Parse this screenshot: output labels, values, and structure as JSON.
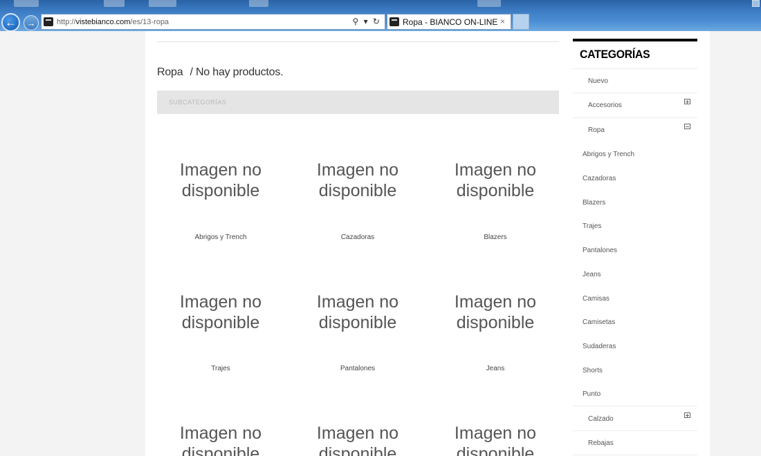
{
  "browser": {
    "url_prefix": "http://",
    "url_domain": "vistebianco.com",
    "url_path": "/es/13-ropa",
    "tab_title": "Ropa - BIANCO ON-LINE",
    "tab_close": "×",
    "address_tools": "⚲ ▾ ↻",
    "back_glyph": "←",
    "forward_glyph": "→"
  },
  "main": {
    "category": "Ropa",
    "status": "/ No hay productos.",
    "subcategories_heading": "SUBCATEGORÍAS",
    "subcategories": [
      {
        "line1": "Imagen no",
        "line2": "disponible",
        "name": "Abrigos y Trench"
      },
      {
        "line1": "Imagen no",
        "line2": "disponible",
        "name": "Cazadoras"
      },
      {
        "line1": "Imagen no",
        "line2": "disponible",
        "name": "Blazers"
      },
      {
        "line1": "Imagen no",
        "line2": "disponible",
        "name": "Trajes"
      },
      {
        "line1": "Imagen no",
        "line2": "disponible",
        "name": "Pantalones"
      },
      {
        "line1": "Imagen no",
        "line2": "disponible",
        "name": "Jeans"
      },
      {
        "line1": "Imagen no",
        "line2": "disponible",
        "name": ""
      },
      {
        "line1": "Imagen no",
        "line2": "disponible",
        "name": ""
      },
      {
        "line1": "Imagen no",
        "line2": "disponible",
        "name": ""
      }
    ]
  },
  "sidebar": {
    "title": "CATEGORÍAS",
    "items": [
      {
        "label": "Nuevo",
        "toggle": ""
      },
      {
        "label": "Accesorios",
        "toggle": "plus"
      },
      {
        "label": "Ropa",
        "toggle": "minus"
      },
      {
        "label": "Abrigos y Trench",
        "toggle": ""
      },
      {
        "label": "Cazadoras",
        "toggle": ""
      },
      {
        "label": "Blazers",
        "toggle": ""
      },
      {
        "label": "Trajes",
        "toggle": ""
      },
      {
        "label": "Pantalones",
        "toggle": ""
      },
      {
        "label": "Jeans",
        "toggle": ""
      },
      {
        "label": "Camisas",
        "toggle": ""
      },
      {
        "label": "Camisetas",
        "toggle": ""
      },
      {
        "label": "Sudaderas",
        "toggle": ""
      },
      {
        "label": "Shorts",
        "toggle": ""
      },
      {
        "label": "Punto",
        "toggle": ""
      },
      {
        "label": "Calzado",
        "toggle": "plus"
      },
      {
        "label": "Rebajas",
        "toggle": ""
      }
    ]
  },
  "colors": {
    "chrome_blue": "#3f7fc7",
    "sidebar_accent": "#000000",
    "subcat_bar": "#e5e5e5"
  }
}
